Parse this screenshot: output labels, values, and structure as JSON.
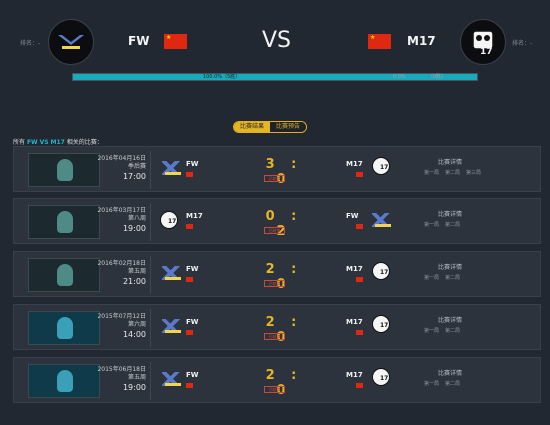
{
  "header": {
    "rank_left": "排名：-",
    "rank_right": "排名：-",
    "team_left": "FW",
    "team_right": "M17",
    "vs": "VS",
    "bar_left_text": "100.0%（5胜）",
    "bar_right_text": "0.0%",
    "bar_right_text2": "（0胜）",
    "win_fraction_left": 1.0,
    "flag_color": "#de2910"
  },
  "tabs": {
    "items": [
      "比赛结果",
      "比赛预告"
    ],
    "active_index": 0
  },
  "all_label": {
    "prefix": "所有",
    "team_a": "FW",
    "vs": "VS",
    "team_b": "M17",
    "suffix": "相关的比赛："
  },
  "matches": [
    {
      "date": "2016年04月16日",
      "stage": "季后赛",
      "time": "17:00",
      "left_team": "FW",
      "right_team": "M17",
      "left_logo": "fw",
      "right_logo": "m17",
      "score": "3 : 0",
      "status": "已结束",
      "detail": "比赛详情",
      "games": [
        "第一局",
        "第二局",
        "第三局"
      ],
      "thumb": "green"
    },
    {
      "date": "2016年03月17日",
      "stage": "第八周",
      "time": "19:00",
      "left_team": "M17",
      "right_team": "FW",
      "left_logo": "m17",
      "right_logo": "fw",
      "score": "0 : 2",
      "status": "已结束",
      "detail": "比赛详情",
      "games": [
        "第一局",
        "第二局"
      ],
      "thumb": "green"
    },
    {
      "date": "2016年02月18日",
      "stage": "第五周",
      "time": "21:00",
      "left_team": "FW",
      "right_team": "M17",
      "left_logo": "fw",
      "right_logo": "m17",
      "score": "2 : 0",
      "status": "已结束",
      "detail": "比赛详情",
      "games": [
        "第一局",
        "第二局"
      ],
      "thumb": "green"
    },
    {
      "date": "2015年07月12日",
      "stage": "第六周",
      "time": "14:00",
      "left_team": "FW",
      "right_team": "M17",
      "left_logo": "fw",
      "right_logo": "m17",
      "score": "2 : 0",
      "status": "已结束",
      "detail": "比赛详情",
      "games": [
        "第一局",
        "第二局"
      ],
      "thumb": "blue"
    },
    {
      "date": "2015年06月18日",
      "stage": "第五周",
      "time": "19:00",
      "left_team": "FW",
      "right_team": "M17",
      "left_logo": "fw",
      "right_logo": "m17",
      "score": "2 : 0",
      "status": "已结束",
      "detail": "比赛详情",
      "games": [
        "第一局",
        "第二局"
      ],
      "thumb": "blue"
    }
  ]
}
